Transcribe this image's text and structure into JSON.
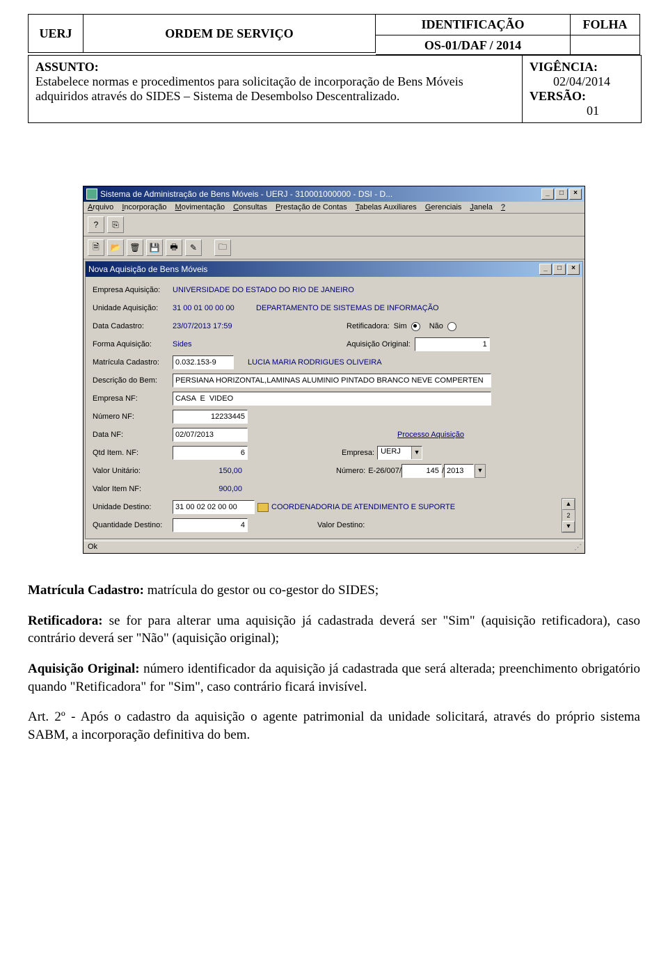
{
  "header": {
    "uerj": "UERJ",
    "ordem": "ORDEM DE SERVIÇO",
    "ident_label": "IDENTIFICAÇÃO",
    "ident_value": "OS-01/DAF / 2014",
    "folha_label": "FOLHA"
  },
  "assunto": {
    "label": "ASSUNTO:",
    "text": "Estabelece normas e procedimentos para solicitação de incorporação de Bens Móveis adquiridos através do SIDES – Sistema de Desembolso Descentralizado.",
    "vigencia_label": "VIGÊNCIA:",
    "vigencia_value": "02/04/2014",
    "versao_label": "VERSÃO:",
    "versao_value": "01"
  },
  "app": {
    "title": "Sistema de Administração de Bens Móveis - UERJ - 310001000000 - DSI - D...",
    "menus": [
      "Arquivo",
      "Incorporação",
      "Movimentação",
      "Consultas",
      "Prestação de Contas",
      "Tabelas Auxiliares",
      "Gerenciais",
      "Janela",
      "?"
    ],
    "inner_title": "Nova Aquisição de Bens Móveis",
    "status": "Ok"
  },
  "form": {
    "empresa_aquisicao_label": "Empresa Aquisição:",
    "empresa_aquisicao_value": "UNIVERSIDADE DO ESTADO DO RIO DE JANEIRO",
    "unidade_aquisicao_label": "Unidade Aquisição:",
    "unidade_aquisicao_code": "31 00 01 00 00 00",
    "unidade_aquisicao_name": "DEPARTAMENTO DE SISTEMAS DE INFORMAÇÃO",
    "data_cadastro_label": "Data Cadastro:",
    "data_cadastro_value": "23/07/2013 17:59",
    "retificadora_label": "Retificadora:",
    "retificadora_sim": "Sim",
    "retificadora_nao": "Não",
    "forma_aquisicao_label": "Forma Aquisição:",
    "forma_aquisicao_value": "Sides",
    "aquisicao_original_label": "Aquisição Original:",
    "aquisicao_original_value": "1",
    "matricula_cadastro_label": "Matrícula Cadastro:",
    "matricula_cadastro_value": "0.032.153-9",
    "matricula_cadastro_name": "LUCIA MARIA RODRIGUES OLIVEIRA",
    "descricao_bem_label": "Descrição do Bem:",
    "descricao_bem_value": "PERSIANA HORIZONTAL,LAMINAS ALUMINIO PINTADO BRANCO NEVE COMPERTEN",
    "empresa_nf_label": "Empresa NF:",
    "empresa_nf_value": "CASA  E  VIDEO",
    "numero_nf_label": "Número NF:",
    "numero_nf_value": "12233445",
    "data_nf_label": "Data NF:",
    "data_nf_value": "02/07/2013",
    "processo_aquisicao_label": "Processo Aquisição",
    "qtd_item_nf_label": "Qtd Item. NF:",
    "qtd_item_nf_value": "6",
    "empresa_label": "Empresa:",
    "empresa_combo": "UERJ",
    "valor_unitario_label": "Valor Unitário:",
    "valor_unitario_value": "150,00",
    "numero_label": "Número:",
    "numero_prefix": "E-26/007/",
    "numero_value": "145",
    "numero_sep": " / ",
    "numero_year": "2013",
    "valor_item_nf_label": "Valor Item NF:",
    "valor_item_nf_value": "900,00",
    "unidade_destino_label": "Unidade Destino:",
    "unidade_destino_code": "31 00 02 02 00 00",
    "unidade_destino_name": "COORDENADORIA DE ATENDIMENTO E SUPORTE",
    "quantidade_destino_label": "Quantidade Destino:",
    "quantidade_destino_value": "4",
    "valor_destino_label": "Valor Destino:",
    "scroll_count": "2"
  },
  "body": {
    "p1_bold": "Matrícula Cadastro:",
    "p1_rest": " matrícula do gestor ou co-gestor do SIDES;",
    "p2_bold": "Retificadora:",
    "p2_rest": " se for para alterar uma aquisição já cadastrada deverá ser \"Sim\" (aquisição retificadora), caso contrário deverá ser \"Não\" (aquisição original);",
    "p3_bold": "Aquisição Original:",
    "p3_rest": " número identificador da aquisição já cadastrada que será alterada; preenchimento obrigatório quando \"Retificadora\" for \"Sim\", caso contrário ficará invisível.",
    "art": "Art. 2º - Após o cadastro da aquisição o agente patrimonial da unidade solicitará, através do próprio sistema SABM, a incorporação definitiva do bem."
  }
}
